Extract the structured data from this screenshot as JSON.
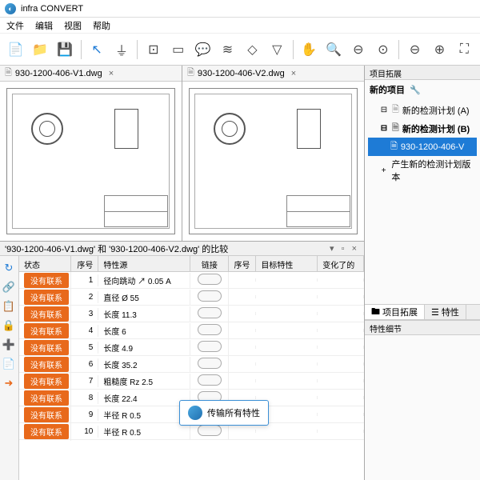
{
  "title": "infra CONVERT",
  "menu": {
    "file": "文件",
    "edit": "编辑",
    "view": "视图",
    "help": "帮助"
  },
  "tabs": {
    "left": "930-1200-406-V1.dwg",
    "right": "930-1200-406-V2.dwg"
  },
  "compare_title": "'930-1200-406-V1.dwg' 和 '930-1200-406-V2.dwg' 的比较",
  "columns": {
    "status": "状态",
    "seq": "序号",
    "feature_src": "特性源",
    "link": "链接",
    "seq2": "序号",
    "target": "目标特性",
    "changed": "变化了的"
  },
  "rows": [
    {
      "status": "没有联系",
      "seq": "1",
      "feat": "径向跳动 ↗ 0.05 A"
    },
    {
      "status": "没有联系",
      "seq": "2",
      "feat": "直径 Ø 55"
    },
    {
      "status": "没有联系",
      "seq": "3",
      "feat": "长度 11.3"
    },
    {
      "status": "没有联系",
      "seq": "4",
      "feat": "长度 6"
    },
    {
      "status": "没有联系",
      "seq": "5",
      "feat": "长度 4.9"
    },
    {
      "status": "没有联系",
      "seq": "6",
      "feat": "长度 35.2"
    },
    {
      "status": "没有联系",
      "seq": "7",
      "feat": "粗糙度 Rz 2.5"
    },
    {
      "status": "没有联系",
      "seq": "8",
      "feat": "长度 22.4"
    },
    {
      "status": "没有联系",
      "seq": "9",
      "feat": "半径 R 0.5"
    },
    {
      "status": "没有联系",
      "seq": "10",
      "feat": "半径 R 0.5"
    }
  ],
  "float_button": "传输所有特性",
  "project": {
    "header": "项目拓展",
    "title": "新的项目",
    "plan_a": "新的检测计划 (A)",
    "plan_b": "新的检测计划 (B)",
    "file": "930-1200-406-V",
    "generate": "产生新的检测计划版本"
  },
  "rtabs": {
    "expand": "项目拓展",
    "prop": "特性"
  },
  "detail_header": "特性细节"
}
